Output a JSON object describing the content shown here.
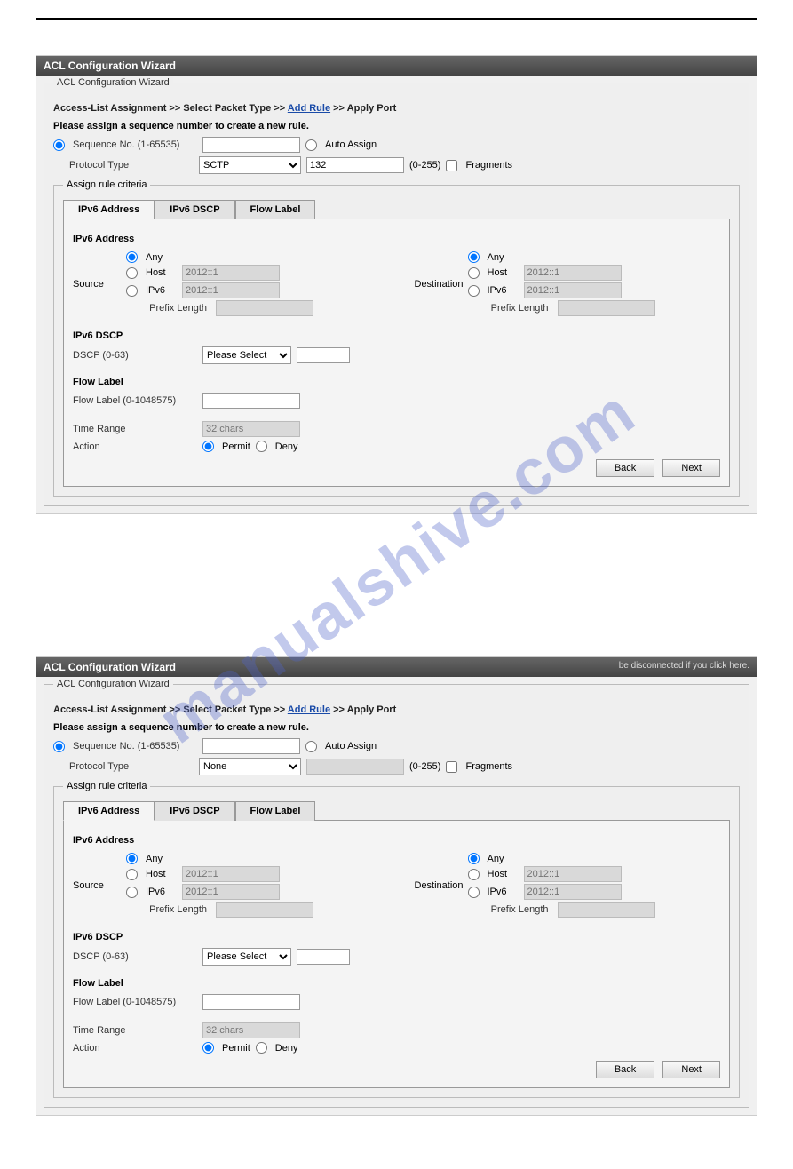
{
  "watermark": "manualshive.com",
  "panel1": {
    "title": "ACL Configuration Wizard",
    "fieldset_legend": "ACL Configuration Wizard",
    "breadcrumb": {
      "a": "Access-List Assignment",
      "sep": ">>",
      "b": "Select Packet Type",
      "c": "Add Rule",
      "d": "Apply Port"
    },
    "instruction": "Please assign a sequence number to create a new rule.",
    "seq_label": "Sequence No. (1-65535)",
    "auto_assign": "Auto Assign",
    "protocol_type_label": "Protocol Type",
    "protocol_type_value": "SCTP",
    "protocol_num": "132",
    "protocol_range": "(0-255)",
    "fragments": "Fragments",
    "criteria_legend": "Assign rule criteria",
    "tabs": {
      "t1": "IPv6 Address",
      "t2": "IPv6 DSCP",
      "t3": "Flow Label"
    },
    "ipv6_address_title": "IPv6 Address",
    "any": "Any",
    "host": "Host",
    "ipv6": "IPv6",
    "prefix_length": "Prefix Length",
    "source": "Source",
    "destination": "Destination",
    "host_ph": "2012::1",
    "ipv6_ph": "2012::1",
    "ipv6_dscp_title": "IPv6 DSCP",
    "dscp_label": "DSCP (0-63)",
    "dscp_select": "Please Select",
    "flow_label_title": "Flow Label",
    "flow_label_label": "Flow Label (0-1048575)",
    "time_range_label": "Time Range",
    "time_range_ph": "32 chars",
    "action_label": "Action",
    "permit": "Permit",
    "deny": "Deny",
    "back": "Back",
    "next": "Next"
  },
  "panel2": {
    "title": "ACL Configuration Wizard",
    "header_right": "be disconnected if you click here.",
    "fieldset_legend": "ACL Configuration Wizard",
    "breadcrumb": {
      "a": "Access-List Assignment",
      "sep": ">>",
      "b": "Select Packet Type",
      "c": "Add Rule",
      "d": "Apply Port"
    },
    "instruction": "Please assign a sequence number to create a new rule.",
    "seq_label": "Sequence No. (1-65535)",
    "auto_assign": "Auto Assign",
    "protocol_type_label": "Protocol Type",
    "protocol_type_value": "None",
    "protocol_num": "",
    "protocol_range": "(0-255)",
    "fragments": "Fragments",
    "criteria_legend": "Assign rule criteria",
    "tabs": {
      "t1": "IPv6 Address",
      "t2": "IPv6 DSCP",
      "t3": "Flow Label"
    },
    "ipv6_address_title": "IPv6 Address",
    "any": "Any",
    "host": "Host",
    "ipv6": "IPv6",
    "prefix_length": "Prefix Length",
    "source": "Source",
    "destination": "Destination",
    "host_ph": "2012::1",
    "ipv6_ph": "2012::1",
    "ipv6_dscp_title": "IPv6 DSCP",
    "dscp_label": "DSCP (0-63)",
    "dscp_select": "Please Select",
    "flow_label_title": "Flow Label",
    "flow_label_label": "Flow Label (0-1048575)",
    "time_range_label": "Time Range",
    "time_range_ph": "32 chars",
    "action_label": "Action",
    "permit": "Permit",
    "deny": "Deny",
    "back": "Back",
    "next": "Next"
  }
}
